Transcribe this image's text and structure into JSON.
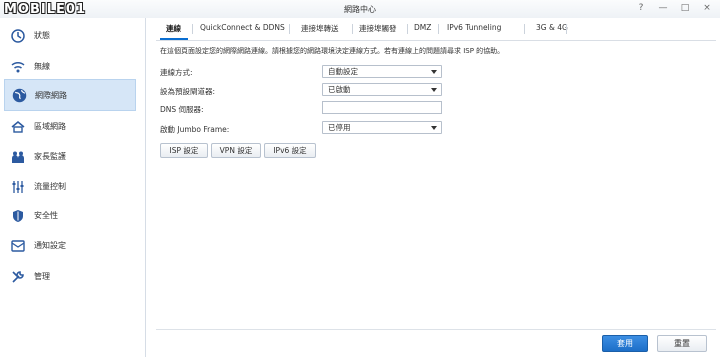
{
  "window": {
    "logo_text": "MOBILE01",
    "title": "網路中心",
    "buttons": [
      "?",
      "—",
      "□",
      "×"
    ]
  },
  "sidebar": {
    "items": [
      {
        "label": "狀態",
        "icon": "status-icon"
      },
      {
        "label": "無線",
        "icon": "wifi-icon"
      },
      {
        "label": "網際網路",
        "icon": "globe-icon",
        "active": true
      },
      {
        "label": "區域網路",
        "icon": "house-network-icon"
      },
      {
        "label": "家長監護",
        "icon": "family-icon"
      },
      {
        "label": "流量控制",
        "icon": "sliders-icon"
      },
      {
        "label": "安全性",
        "icon": "shield-icon"
      },
      {
        "label": "通知設定",
        "icon": "notification-icon"
      },
      {
        "label": "管理",
        "icon": "tools-icon"
      }
    ]
  },
  "tabs": [
    {
      "label": "連線",
      "active": true
    },
    {
      "label": "QuickConnect & DDNS"
    },
    {
      "label": "連接埠轉送"
    },
    {
      "label": "連接埠觸發"
    },
    {
      "label": "DMZ"
    },
    {
      "label": "IPv6 Tunneling"
    },
    {
      "label": "3G & 4G"
    }
  ],
  "main": {
    "description": "在這個頁面設定您的網際網路連線。請根據您的網路環境決定連線方式。若有連線上的問題請尋求 ISP 的協助。",
    "fields": [
      {
        "label": "連線方式:",
        "type": "select",
        "value": "自動設定"
      },
      {
        "label": "設為預設閘道器:",
        "type": "select",
        "value": "已啟動"
      },
      {
        "label": "DNS 伺服器:",
        "type": "input",
        "value": ""
      },
      {
        "label": "啟動 Jumbo Frame:",
        "type": "select",
        "value": "已停用"
      }
    ],
    "buttons": [
      "ISP 設定",
      "VPN 設定",
      "IPv6 設定"
    ]
  },
  "footer": {
    "apply": "套用",
    "reset": "重置"
  }
}
